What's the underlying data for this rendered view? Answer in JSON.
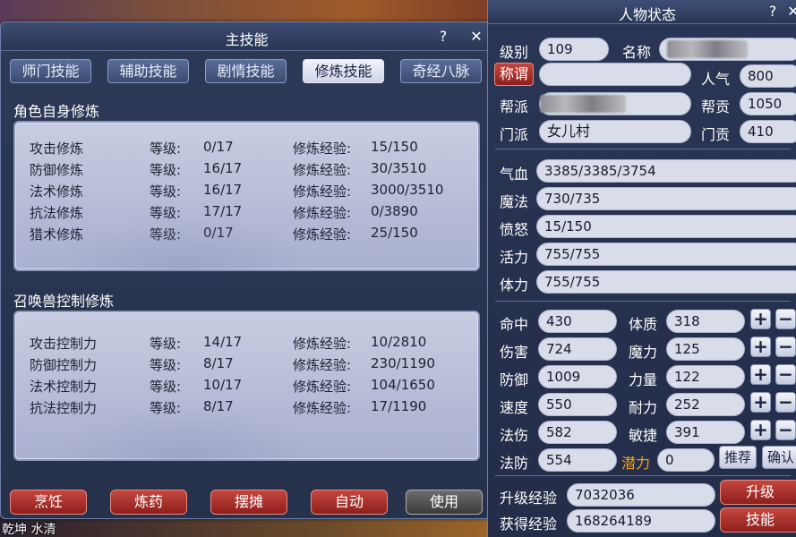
{
  "skills_window": {
    "title": "主技能",
    "help": "?",
    "close": "✕",
    "tabs": [
      "师门技能",
      "辅助技能",
      "剧情技能",
      "修炼技能",
      "奇经八脉"
    ],
    "active_tab": "修炼技能",
    "level_label": "等级:",
    "exp_label": "修炼经验:",
    "self_cultivation": {
      "title": "角色自身修炼",
      "rows": [
        {
          "name": "攻击修炼",
          "level": "0/17",
          "exp": "15/150"
        },
        {
          "name": "防御修炼",
          "level": "16/17",
          "exp": "30/3510"
        },
        {
          "name": "法术修炼",
          "level": "16/17",
          "exp": "3000/3510"
        },
        {
          "name": "抗法修炼",
          "level": "17/17",
          "exp": "0/3890"
        },
        {
          "name": "猎术修炼",
          "level": "0/17",
          "exp": "25/150"
        }
      ]
    },
    "pet_cultivation": {
      "title": "召唤兽控制修炼",
      "rows": [
        {
          "name": "攻击控制力",
          "level": "14/17",
          "exp": "10/2810"
        },
        {
          "name": "防御控制力",
          "level": "8/17",
          "exp": "230/1190"
        },
        {
          "name": "法术控制力",
          "level": "10/17",
          "exp": "104/1650"
        },
        {
          "name": "抗法控制力",
          "level": "8/17",
          "exp": "17/1190"
        }
      ]
    },
    "buttons": [
      "烹饪",
      "炼药",
      "摆摊",
      "自动",
      "使用"
    ]
  },
  "status_window": {
    "title": "人物状态",
    "help": "?",
    "close": "✕",
    "level_label": "级别",
    "level": "109",
    "name_label": "名称",
    "title_button": "称谓",
    "popularity_label": "人气",
    "popularity": "800",
    "faction_label": "帮派",
    "contribution_label": "帮贡",
    "contribution": "1050",
    "school_label": "门派",
    "school": "女儿村",
    "school_contrib_label": "门贡",
    "school_contrib": "410",
    "vitals": [
      {
        "label": "气血",
        "value": "3385/3385/3754"
      },
      {
        "label": "魔法",
        "value": "730/735"
      },
      {
        "label": "愤怒",
        "value": "15/150"
      },
      {
        "label": "活力",
        "value": "755/755"
      },
      {
        "label": "体力",
        "value": "755/755"
      }
    ],
    "stats_left": [
      {
        "label": "命中",
        "value": "430"
      },
      {
        "label": "伤害",
        "value": "724"
      },
      {
        "label": "防御",
        "value": "1009"
      },
      {
        "label": "速度",
        "value": "550"
      },
      {
        "label": "法伤",
        "value": "582"
      },
      {
        "label": "法防",
        "value": "554"
      }
    ],
    "stats_right": [
      {
        "label": "体质",
        "value": "318"
      },
      {
        "label": "魔力",
        "value": "125"
      },
      {
        "label": "力量",
        "value": "122"
      },
      {
        "label": "耐力",
        "value": "252"
      },
      {
        "label": "敏捷",
        "value": "391"
      }
    ],
    "potential_label": "潜力",
    "potential": "0",
    "plus": "+",
    "minus": "−",
    "recommend_button": "推荐",
    "confirm_button": "确认",
    "upgrade_exp_label": "升级经验",
    "upgrade_exp": "7032036",
    "gained_exp_label": "获得经验",
    "gained_exp": "168264189",
    "upgrade_button": "升级",
    "skill_button": "技能"
  },
  "background": {
    "caption": "乾坤 水清"
  },
  "colors": {
    "potential_label": "#f0a020",
    "red_button": "#a8302a"
  }
}
